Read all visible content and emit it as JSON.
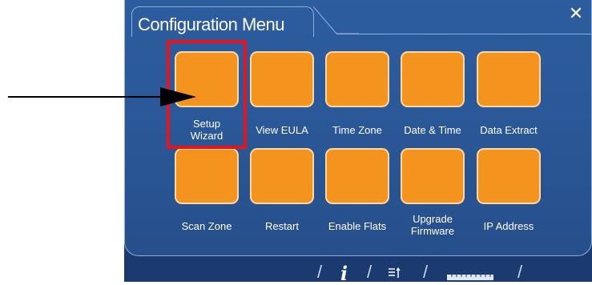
{
  "window": {
    "title": "Configuration Menu",
    "close_glyph": "✕"
  },
  "tiles": [
    {
      "label": "Setup\nWizard"
    },
    {
      "label": "View EULA"
    },
    {
      "label": "Time Zone"
    },
    {
      "label": "Date & Time"
    },
    {
      "label": "Data Extract"
    },
    {
      "label": "Scan Zone"
    },
    {
      "label": "Restart"
    },
    {
      "label": "Enable Flats"
    },
    {
      "label": "Upgrade\nFirmware"
    },
    {
      "label": "IP Address"
    }
  ],
  "toolbar": {
    "info_glyph": "i",
    "separator": "/",
    "icons": [
      "info-icon",
      "sort-icon",
      "ruler-icon"
    ]
  },
  "colors": {
    "panel": "#2a5797",
    "tile": "#f5931f",
    "highlight": "#e8141d"
  }
}
